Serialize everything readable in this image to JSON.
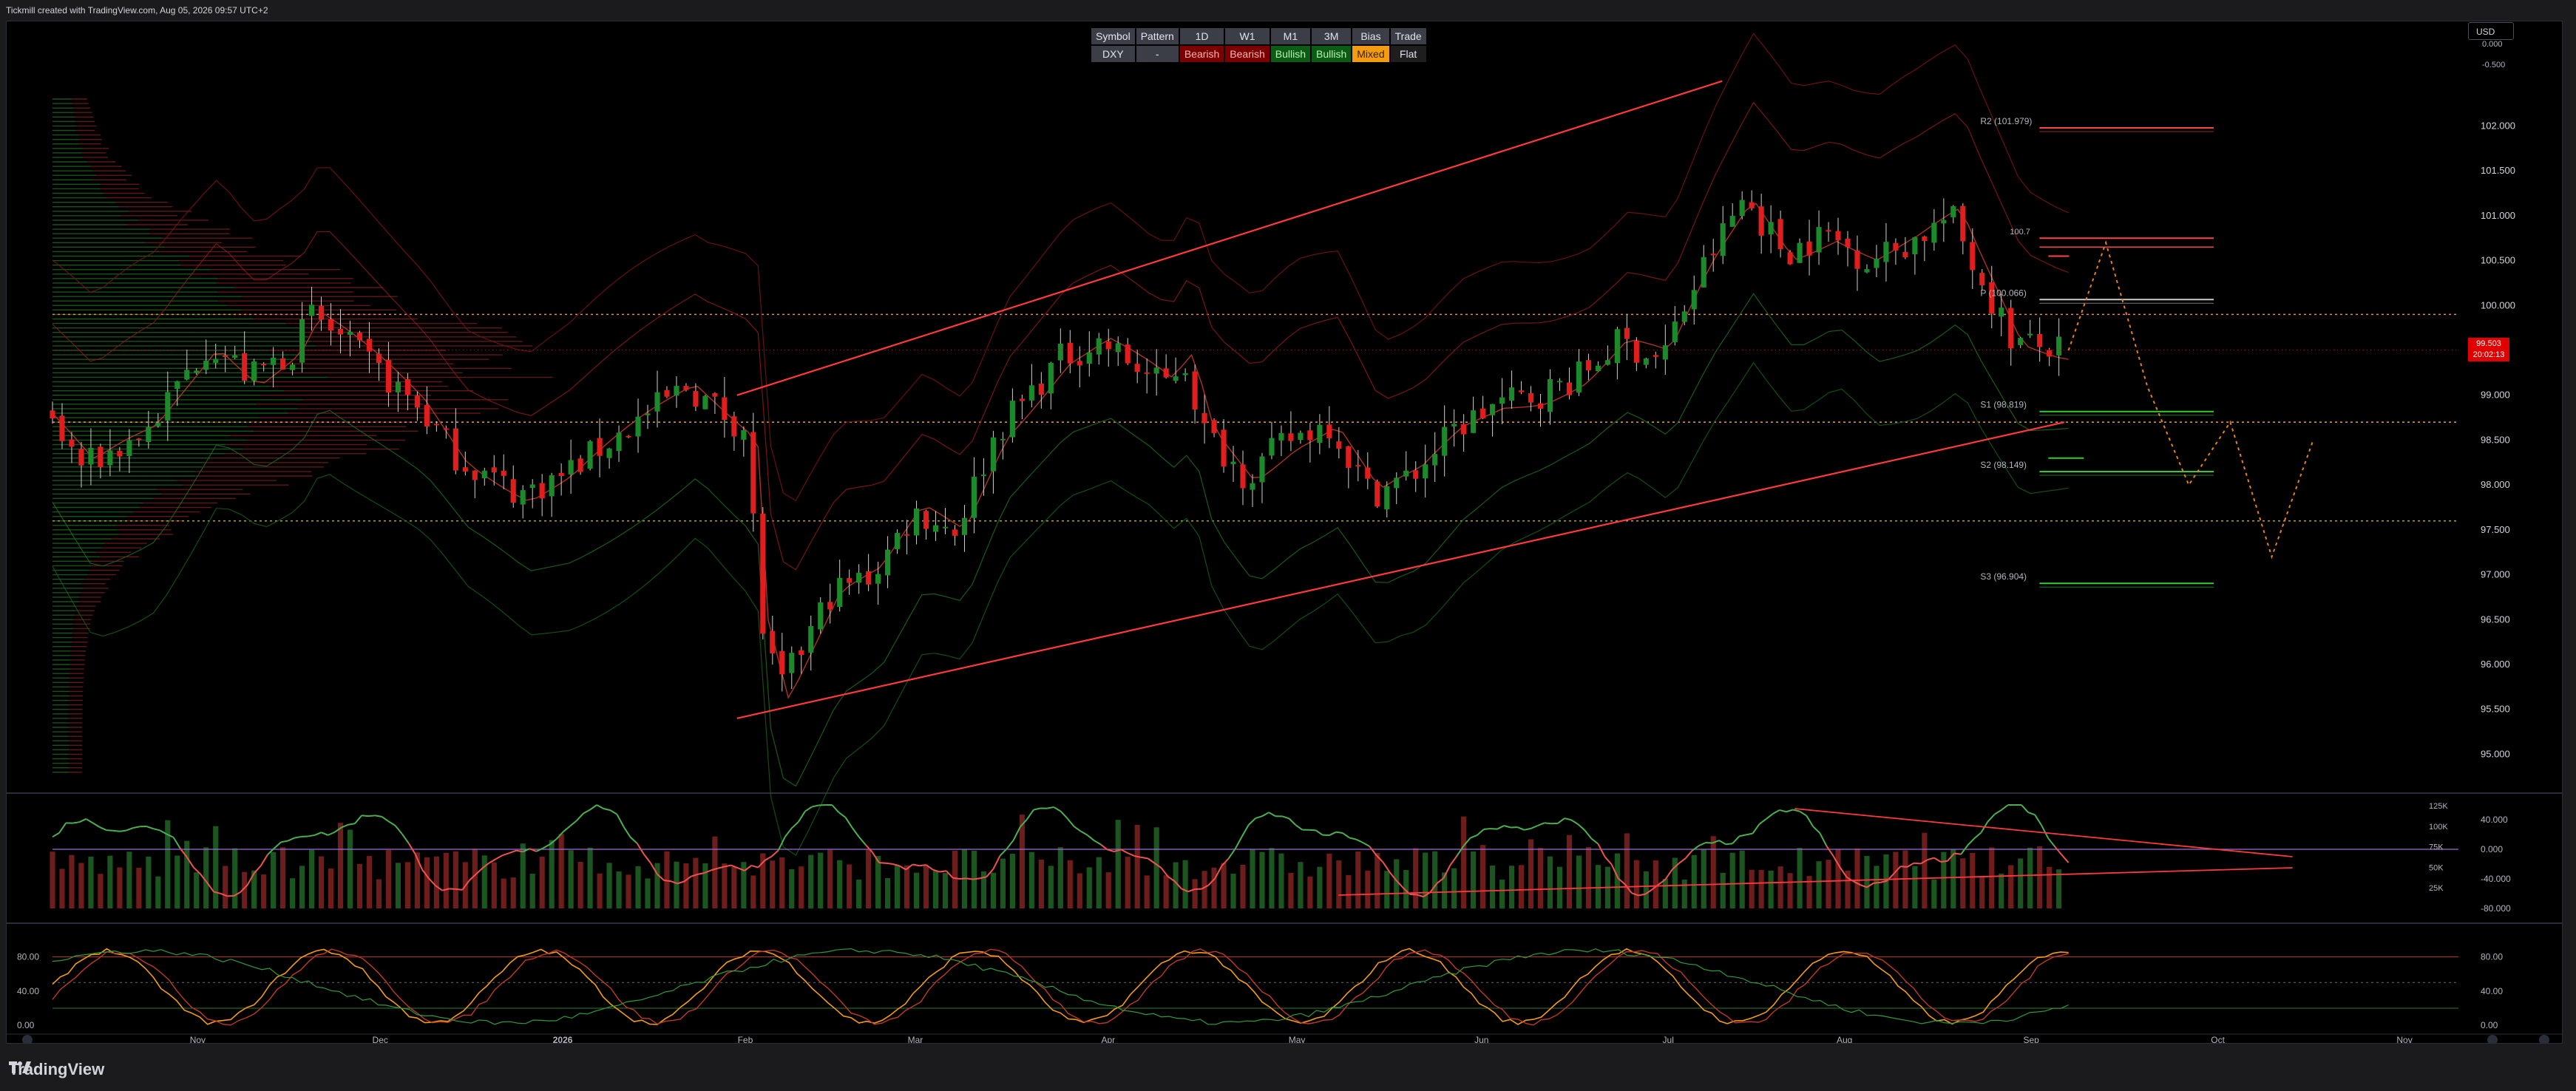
{
  "header": {
    "attribution": "Tickmill created with TradingView.com, Aug 05, 2026 09:57 UTC+2"
  },
  "currency": "USD",
  "bias_table": {
    "headers": [
      "Symbol",
      "Pattern",
      "1D",
      "W1",
      "M1",
      "3M",
      "Bias",
      "Trade"
    ],
    "row": [
      {
        "text": "DXY",
        "kind": "sym"
      },
      {
        "text": "-",
        "kind": "sym"
      },
      {
        "text": "Bearish",
        "kind": "bear"
      },
      {
        "text": "Bearish",
        "kind": "bear"
      },
      {
        "text": "Bullish",
        "kind": "bull"
      },
      {
        "text": "Bullish",
        "kind": "bull"
      },
      {
        "text": "Mixed",
        "kind": "mixed"
      },
      {
        "text": "Flat",
        "kind": "flat"
      }
    ]
  },
  "last_price": {
    "price": "99.503",
    "countdown": "20:02:13"
  },
  "colors": {
    "bull": "#1b8a2a",
    "bear": "#e01e1e",
    "channel": "#ff3a3a",
    "background": "#000000"
  },
  "chart_data": [
    {
      "type": "candlestick",
      "ylim": [
        94.6,
        103.0
      ],
      "yticks": [
        "102.000",
        "101.500",
        "101.000",
        "100.500",
        "100.000",
        "99.000",
        "98.500",
        "98.000",
        "97.500",
        "97.000",
        "96.500",
        "96.000",
        "95.500",
        "95.000"
      ],
      "ytick_values": [
        102.0,
        101.5,
        101.0,
        100.5,
        100.0,
        99.0,
        98.5,
        98.0,
        97.5,
        97.0,
        96.5,
        96.0,
        95.5,
        95.0
      ],
      "time_labels": [
        "Nov",
        "Dec",
        "2026",
        "Feb",
        "Mar",
        "Apr",
        "May",
        "Jun",
        "Jul",
        "Aug",
        "Sep",
        "Oct",
        "Nov"
      ],
      "time_label_positions": [
        0.07,
        0.158,
        0.246,
        0.334,
        0.416,
        0.509,
        0.6,
        0.689,
        0.779,
        0.864,
        0.954,
        1.044,
        1.134
      ],
      "close_anchors": [
        [
          0,
          98.8
        ],
        [
          0.02,
          98.2
        ],
        [
          0.05,
          98.6
        ],
        [
          0.08,
          99.6
        ],
        [
          0.1,
          99.2
        ],
        [
          0.12,
          99.5
        ],
        [
          0.13,
          99.9
        ],
        [
          0.15,
          99.5
        ],
        [
          0.18,
          98.9
        ],
        [
          0.2,
          98.3
        ],
        [
          0.23,
          97.9
        ],
        [
          0.25,
          98.1
        ],
        [
          0.28,
          98.6
        ],
        [
          0.31,
          99.1
        ],
        [
          0.34,
          98.6
        ],
        [
          0.345,
          96.6
        ],
        [
          0.355,
          95.7
        ],
        [
          0.38,
          96.8
        ],
        [
          0.4,
          97.0
        ],
        [
          0.42,
          97.7
        ],
        [
          0.44,
          97.5
        ],
        [
          0.46,
          98.6
        ],
        [
          0.49,
          99.4
        ],
        [
          0.51,
          99.6
        ],
        [
          0.54,
          99.1
        ],
        [
          0.55,
          99.4
        ],
        [
          0.56,
          98.6
        ],
        [
          0.58,
          98.1
        ],
        [
          0.6,
          98.5
        ],
        [
          0.62,
          98.7
        ],
        [
          0.64,
          97.9
        ],
        [
          0.66,
          98.1
        ],
        [
          0.68,
          98.6
        ],
        [
          0.7,
          98.9
        ],
        [
          0.72,
          99.0
        ],
        [
          0.74,
          99.2
        ],
        [
          0.76,
          99.6
        ],
        [
          0.78,
          99.4
        ],
        [
          0.8,
          100.4
        ],
        [
          0.82,
          101.2
        ],
        [
          0.84,
          100.6
        ],
        [
          0.86,
          100.8
        ],
        [
          0.88,
          100.5
        ],
        [
          0.9,
          100.7
        ],
        [
          0.92,
          101.0
        ],
        [
          0.93,
          100.5
        ],
        [
          0.95,
          99.6
        ],
        [
          0.97,
          99.5
        ]
      ],
      "channel": {
        "upper": [
          [
            0.33,
            99.0
          ],
          [
            0.805,
            102.5
          ]
        ],
        "lower": [
          [
            0.33,
            95.4
          ],
          [
            0.97,
            98.7
          ]
        ],
        "middle": [
          [
            0.33,
            97.2
          ],
          [
            0.96,
            100.2
          ]
        ]
      },
      "horizontal_levels": [
        {
          "price": 99.9,
          "color": "#e08a6a"
        },
        {
          "price": 98.7,
          "color": "#e0a060"
        },
        {
          "price": 97.6,
          "color": "#b0a050"
        }
      ],
      "pivots": [
        {
          "label": "R2 (101.979)",
          "price": 101.979,
          "color": "#ff4444"
        },
        {
          "label": "P (100.066)",
          "price": 100.066,
          "color": "#cccccc"
        },
        {
          "label": "S1 (98.819)",
          "price": 98.819,
          "color": "#33cc33"
        },
        {
          "label": "S2 (98.149)",
          "price": 98.149,
          "color": "#33cc33"
        },
        {
          "label": "S3 (96.904)",
          "price": 96.904,
          "color": "#33cc33"
        }
      ],
      "pivot_short_labels": [
        {
          "label": "100.7",
          "price": 100.75
        }
      ],
      "projection": [
        [
          0.972,
          99.5
        ],
        [
          0.99,
          100.7
        ],
        [
          1.01,
          99.1
        ],
        [
          1.03,
          98.0
        ],
        [
          1.05,
          98.7
        ],
        [
          1.07,
          97.2
        ],
        [
          1.09,
          98.5
        ]
      ]
    },
    {
      "type": "line",
      "name": "oscillator",
      "yticks": [
        "40.000",
        "0.000",
        "-40.000",
        "-80.000"
      ],
      "ytick_values": [
        40,
        0,
        -40,
        -80
      ],
      "ylim": [
        -80,
        70
      ],
      "volume_yticks": [
        "125K",
        "100K",
        "75K",
        "50K",
        "25K"
      ],
      "volume_ytick_values": [
        125,
        100,
        75,
        50,
        25
      ],
      "volume_ylim": [
        0,
        135
      ]
    },
    {
      "type": "line",
      "name": "stochastic",
      "yticks": [
        "80.00",
        "40.00",
        "0.00"
      ],
      "ytick_values": [
        80,
        40,
        0
      ],
      "ylim": [
        -5,
        95
      ],
      "left_yticks": [
        "80.00",
        "40.00",
        "0.00"
      ]
    }
  ]
}
